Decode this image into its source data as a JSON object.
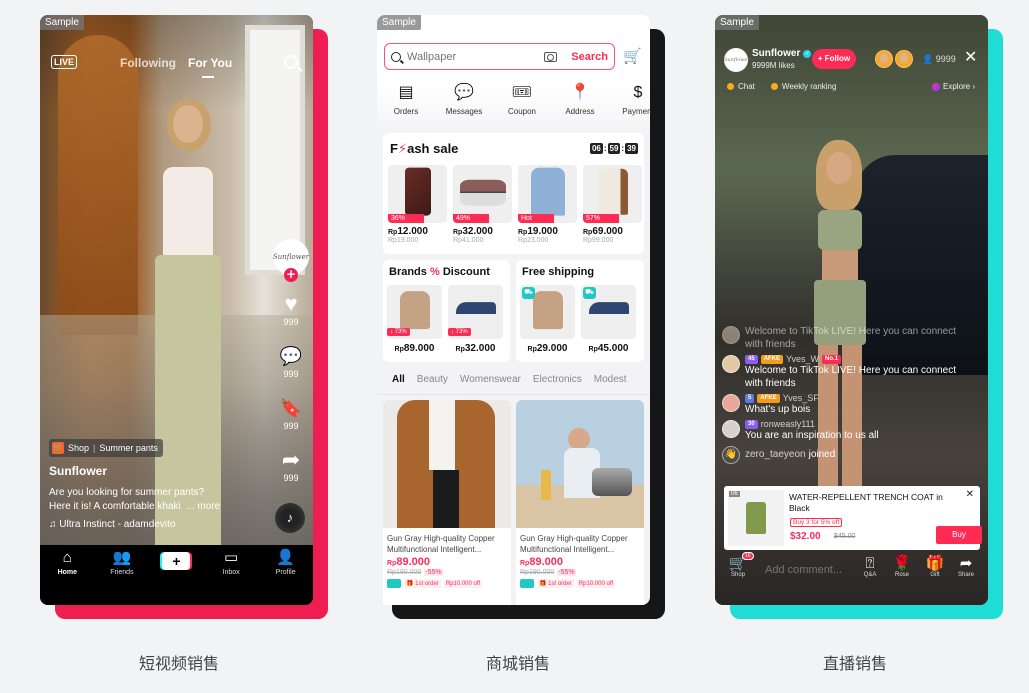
{
  "watermark": "Sample",
  "captions": [
    "短视频销售",
    "商城销售",
    "直播销售"
  ],
  "colors": {
    "tiktok_red": "#fe2c55",
    "tiktok_cyan": "#25f4ee",
    "panel1_backplate": "#ee1d52",
    "panel2_backplate": "#161616",
    "panel3_backplate": "#1fdcd4"
  },
  "short_video": {
    "live_label": "LIVE",
    "tabs": [
      {
        "label": "Following",
        "active": false
      },
      {
        "label": "For You",
        "active": true
      }
    ],
    "search_icon": "search-icon",
    "creator_avatar_text": "Sunflower",
    "actions": [
      {
        "icon": "heart-icon",
        "glyph": "♥",
        "count": "999"
      },
      {
        "icon": "comment-icon",
        "glyph": "💬",
        "count": "999"
      },
      {
        "icon": "bookmark-icon",
        "glyph": "🔖",
        "count": "999"
      },
      {
        "icon": "share-icon",
        "glyph": "➦",
        "count": "999"
      }
    ],
    "shop_chip": {
      "label": "Shop",
      "product": "Summer pants"
    },
    "author": "Sunflower",
    "description_line1": "Are you looking for summer pants?",
    "description_line2": "Here it is! A comfortable khaki",
    "more": "... more",
    "music": "Ultra Instinct - adamdevito",
    "nav": [
      {
        "label": "Home",
        "icon": "home-icon",
        "glyph": "⌂"
      },
      {
        "label": "Friends",
        "icon": "friends-icon",
        "glyph": "👥"
      },
      {
        "label": "",
        "icon": "create-icon",
        "glyph": "+"
      },
      {
        "label": "Inbox",
        "icon": "inbox-icon",
        "glyph": "▭"
      },
      {
        "label": "Profile",
        "icon": "profile-icon",
        "glyph": "👤"
      }
    ]
  },
  "mall": {
    "search": {
      "placeholder": "Wallpaper",
      "button": "Search"
    },
    "shortcuts": [
      {
        "label": "Orders",
        "glyph": "▤"
      },
      {
        "label": "Messages",
        "glyph": "💬"
      },
      {
        "label": "Coupon",
        "glyph": "🎟"
      },
      {
        "label": "Address",
        "glyph": "📍"
      },
      {
        "label": "Payment",
        "glyph": "$"
      }
    ],
    "flash_sale": {
      "title_pre": "F",
      "title_bolt": "⚡",
      "title_post": "ash sale",
      "timer": [
        "06",
        "59",
        "39"
      ],
      "items": [
        {
          "badge": "36%",
          "price": "12.000",
          "old": "Rp19.000",
          "product": "phone-case"
        },
        {
          "badge": "49%",
          "price": "32.000",
          "old": "Rp41.000",
          "product": "jewelry-box"
        },
        {
          "badge": "Hot",
          "price": "19.000",
          "old": "Rp23.000",
          "product": "blazer"
        },
        {
          "badge": "57%",
          "price": "69.000",
          "old": "Rp99.000",
          "product": "boots"
        }
      ]
    },
    "currency": "Rp",
    "brands_discount": {
      "title_a": "Brands",
      "title_symbol": "%",
      "title_b": "Discount",
      "items": [
        {
          "badge": "↓ 73%",
          "price": "89.000",
          "product": "sweater"
        },
        {
          "badge": "↓ 73%",
          "price": "32.000",
          "product": "sneakers"
        }
      ]
    },
    "free_shipping": {
      "title": "Free shipping",
      "items": [
        {
          "price": "29.000",
          "product": "sweater"
        },
        {
          "price": "45.000",
          "product": "sneakers"
        }
      ]
    },
    "categories": [
      {
        "label": "All",
        "active": true
      },
      {
        "label": "Beauty",
        "active": false
      },
      {
        "label": "Womenswear",
        "active": false
      },
      {
        "label": "Electronics",
        "active": false
      },
      {
        "label": "Modest",
        "active": false
      }
    ],
    "products": [
      {
        "title": "Gun Gray High-quality Copper Multifunctional Intelligent...",
        "price": "89.000",
        "old_price": "Rp190.000",
        "discount": "-55%",
        "tag1": "1st order",
        "tag2": "Rp10.000 off",
        "image": "trench-coat"
      },
      {
        "title": "Gun Gray High-quality Copper Multifunctional Intelligent...",
        "price": "89.000",
        "old_price": "Rp190.000",
        "discount": "-55%",
        "tag1": "1st order",
        "tag2": "Rp10.000 off",
        "image": "rice-cooker"
      }
    ]
  },
  "live": {
    "host": {
      "name": "Sunflower",
      "likes": "9999M likes",
      "avatar_text": "Sunflower"
    },
    "follow": "+ Follow",
    "viewer_count": "9999",
    "chat_label": "Chat",
    "ranking_label": "Weekly ranking",
    "explore_label": "Explore ›",
    "comments": [
      {
        "faded": true,
        "user": "",
        "badges": [],
        "text": "Welcome to TikTok LIVE! Here you can connect with friends"
      },
      {
        "faded": false,
        "user": "Yves_W",
        "badges": [
          {
            "cls": "b-level",
            "text": "45"
          },
          {
            "cls": "b-afke",
            "text": "AFKE"
          },
          {
            "cls": "b-no1",
            "text": "No.1"
          }
        ],
        "text": "Welcome to TikTok LIVE! Here you can connect with friends"
      },
      {
        "faded": false,
        "user": "Yves_SF",
        "badges": [
          {
            "cls": "b-blue",
            "text": "5"
          },
          {
            "cls": "b-afke",
            "text": "AFKE"
          }
        ],
        "text": "What's up bois"
      },
      {
        "faded": false,
        "user": "ronweasly111",
        "badges": [
          {
            "cls": "b-level",
            "text": "30"
          }
        ],
        "text": "You are an inspiration to us all"
      }
    ],
    "joined": {
      "user": "zero_taeyeon",
      "action": "joined"
    },
    "product": {
      "index": "06",
      "name": "WATER-REPELLENT TRENCH COAT in Black",
      "promo": "Buy 3 for 5% off",
      "price": "$32.00",
      "old_price": "$45.00",
      "buy": "Buy"
    },
    "bottom": {
      "shop": "Shop",
      "cart_count": "16",
      "comment_placeholder": "Add comment...",
      "qa": "Q&A",
      "rose": "Rose",
      "gift": "Gift",
      "share": "Share"
    }
  }
}
